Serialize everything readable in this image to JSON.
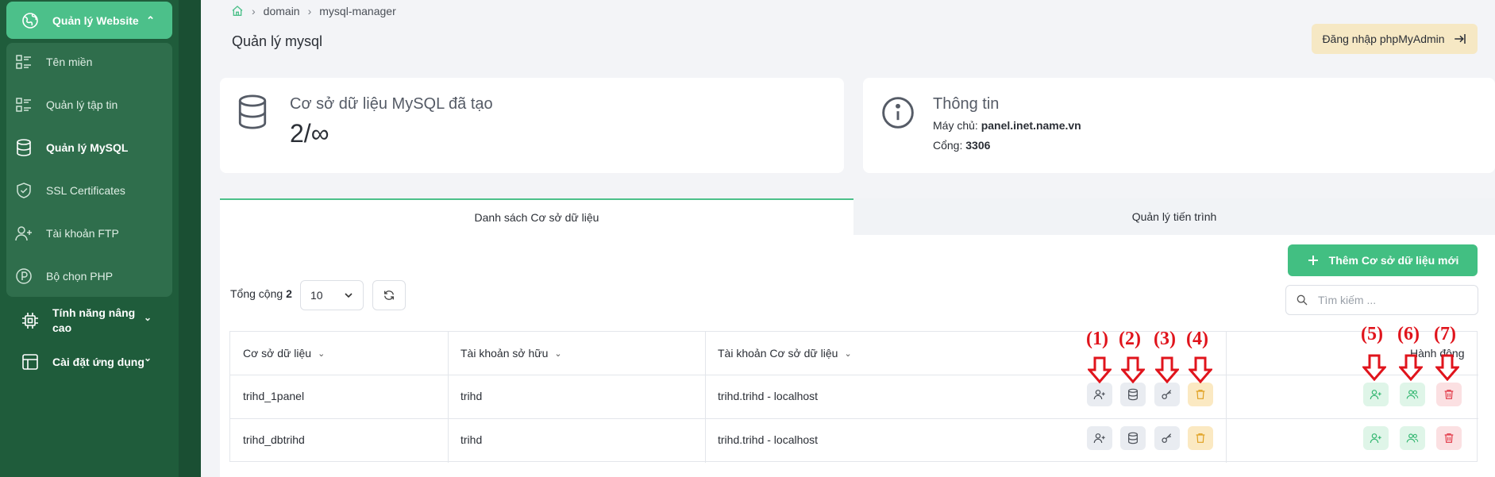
{
  "sidebar": {
    "top": {
      "label": "Quản lý Website"
    },
    "items": [
      {
        "label": "Tên miền",
        "icon": "list-icon"
      },
      {
        "label": "Quản lý tập tin",
        "icon": "list-icon"
      },
      {
        "label": "Quản lý MySQL",
        "icon": "database-icon",
        "active": true
      },
      {
        "label": "SSL Certificates",
        "icon": "shield-icon"
      },
      {
        "label": "Tài khoản FTP",
        "icon": "user-add-icon"
      },
      {
        "label": "Bộ chọn PHP",
        "icon": "php-icon"
      }
    ],
    "advanced": {
      "label_line1": "Tính năng nâng",
      "label_line2": "cao"
    },
    "app_settings": {
      "label": "Cài đặt ứng dụng"
    }
  },
  "breadcrumb": {
    "home": "home-icon",
    "items": [
      "domain",
      "mysql-manager"
    ]
  },
  "page": {
    "title": "Quản lý mysql",
    "phpmyadmin_label": "Đăng nhập phpMyAdmin"
  },
  "stats": {
    "title": "Cơ sở dữ liệu MySQL đã tạo",
    "value": "2/∞"
  },
  "info": {
    "title": "Thông tin",
    "server_label": "Máy chủ:",
    "server_value": "panel.inet.name.vn",
    "port_label": "Cổng:",
    "port_value": "3306"
  },
  "tabs": [
    {
      "label": "Danh sách Cơ sở dữ liệu",
      "active": true
    },
    {
      "label": "Quản lý tiến trình",
      "active": false
    }
  ],
  "toolbar": {
    "add_label": "Thêm Cơ sở dữ liệu mới",
    "total_label": "Tổng cộng",
    "total_value": "2",
    "page_size": "10",
    "search_placeholder": "Tìm kiếm ..."
  },
  "table": {
    "columns": [
      "Cơ sở dữ liệu",
      "Tài khoản sở hữu",
      "Tài khoản Cơ sở dữ liệu",
      "Hành động"
    ],
    "rows": [
      {
        "database": "trihd_1panel",
        "owner": "trihd",
        "db_account": "trihd.trihd - localhost"
      },
      {
        "database": "trihd_dbtrihd",
        "owner": "trihd",
        "db_account": "trihd.trihd - localhost"
      }
    ]
  },
  "annotations": [
    "(1)",
    "(2)",
    "(3)",
    "(4)",
    "(5)",
    "(6)",
    "(7)"
  ],
  "colors": {
    "sidebar_bg": "#1f5c3b",
    "accent_green": "#42bf82",
    "annotation_red": "#e0141c",
    "phpmyadmin_bg": "#f6e8c4"
  }
}
